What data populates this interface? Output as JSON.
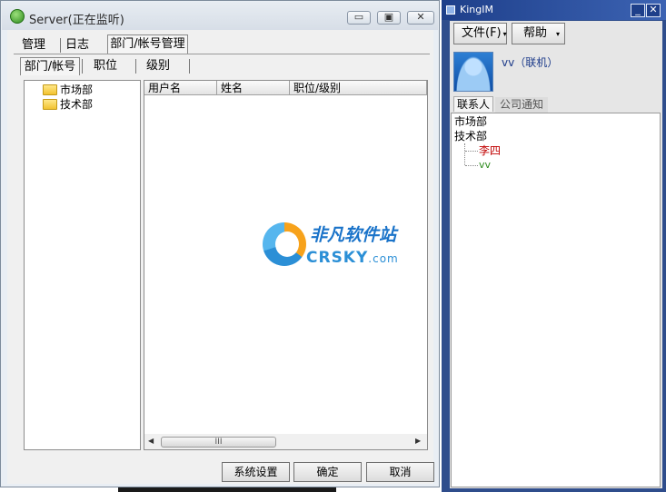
{
  "server": {
    "title": "Server(正在监听)",
    "main_tabs": [
      "管理",
      "日志",
      "部门/帐号管理"
    ],
    "sub_tabs": [
      "部门/帐号",
      "职位",
      "级别"
    ],
    "tree": [
      "市场部",
      "技术部"
    ],
    "columns": [
      "用户名",
      "姓名",
      "职位/级别"
    ],
    "scroll_thumb": "III",
    "buttons": {
      "settings": "系统设置",
      "ok": "确定",
      "cancel": "取消"
    },
    "window_controls": {
      "minimize": "▭",
      "maximize": "▣",
      "close": "✕"
    }
  },
  "watermark": {
    "cn": "非凡软件站",
    "en": "CRSKY",
    "en_suffix": ".com"
  },
  "kingim": {
    "title": "KingIM",
    "menu": {
      "file": "文件(F)",
      "help": "帮助"
    },
    "user": "vv（联机）",
    "tabs": [
      "联系人",
      "公司通知"
    ],
    "contacts": [
      {
        "label": "市场部",
        "level": 0,
        "color": "#000000"
      },
      {
        "label": "技术部",
        "level": 0,
        "color": "#000000"
      },
      {
        "label": "李四",
        "level": 1,
        "color": "#c00000"
      },
      {
        "label": "vv",
        "level": 1,
        "color": "#2e8b1e"
      }
    ]
  }
}
